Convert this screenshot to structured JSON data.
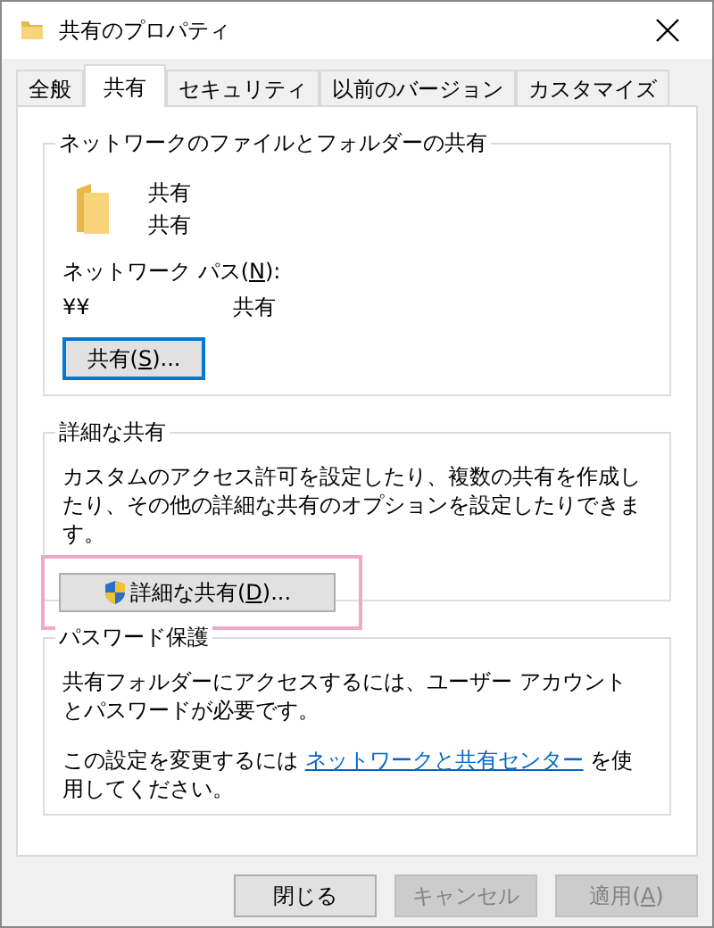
{
  "window": {
    "title": "共有のプロパティ"
  },
  "tabs": [
    {
      "label": "全般",
      "selected": false
    },
    {
      "label": "共有",
      "selected": true
    },
    {
      "label": "セキュリティ",
      "selected": false
    },
    {
      "label": "以前のバージョン",
      "selected": false
    },
    {
      "label": "カスタマイズ",
      "selected": false
    }
  ],
  "network_sharing": {
    "title": "ネットワークのファイルとフォルダーの共有",
    "folder_name": "共有",
    "folder_status": "共有",
    "path_label": {
      "prefix": "ネットワーク パス(",
      "access_key": "N",
      "suffix": "):"
    },
    "path_start": "¥¥",
    "path_end": "共有",
    "share_button": {
      "prefix": "共有(",
      "access_key": "S",
      "suffix": ")...",
      "focused": true
    }
  },
  "advanced_sharing": {
    "title": "詳細な共有",
    "description": "カスタムのアクセス許可を設定したり、複数の共有を作成したり、その他の詳細な共有のオプションを設定したりできます。",
    "button": {
      "prefix": "詳細な共有(",
      "access_key": "D",
      "suffix": ")...",
      "highlighted": true
    }
  },
  "password_protection": {
    "title": "パスワード保護",
    "description": "共有フォルダーにアクセスするには、ユーザー アカウントとパスワードが必要です。",
    "change_prefix": "この設定を変更するには ",
    "link": "ネットワークと共有センター",
    "change_suffix": " を使用してください。"
  },
  "buttons": [
    {
      "prefix": "閉じる",
      "disabled": false
    },
    {
      "prefix": "キャンセル",
      "disabled": true
    },
    {
      "prefix": "適用(",
      "access_key": "A",
      "suffix": ")",
      "disabled": true
    }
  ]
}
